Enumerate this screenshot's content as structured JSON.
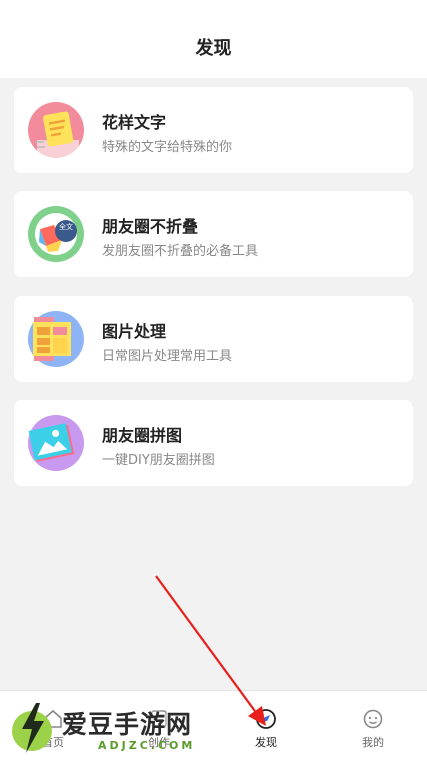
{
  "header": {
    "title": "发现"
  },
  "cards": [
    {
      "title": "花样文字",
      "desc": "特殊的文字给特殊的你",
      "icon": "sticky-note-icon",
      "color": "#f28b9b"
    },
    {
      "title": "朋友圈不折叠",
      "desc": "发朋友圈不折叠的必备工具",
      "icon": "unfold-text-icon",
      "color": "#7fd08a",
      "icon_text": "全文"
    },
    {
      "title": "图片处理",
      "desc": "日常图片处理常用工具",
      "icon": "image-edit-icon",
      "color": "#8fb4f5"
    },
    {
      "title": "朋友圈拼图",
      "desc": "一键DIY朋友圈拼图",
      "icon": "photo-collage-icon",
      "color": "#c79af0"
    }
  ],
  "tabbar": {
    "items": [
      {
        "label": "首页",
        "icon": "home-icon"
      },
      {
        "label": "创作",
        "icon": "create-icon"
      },
      {
        "label": "发现",
        "icon": "compass-icon"
      },
      {
        "label": "我的",
        "icon": "profile-icon"
      }
    ]
  },
  "watermark": {
    "text": "爱豆手游网",
    "domain": "ADJZC.COM"
  },
  "colors": {
    "annotation_arrow": "#e8201c",
    "background": "#f2f2f2"
  }
}
